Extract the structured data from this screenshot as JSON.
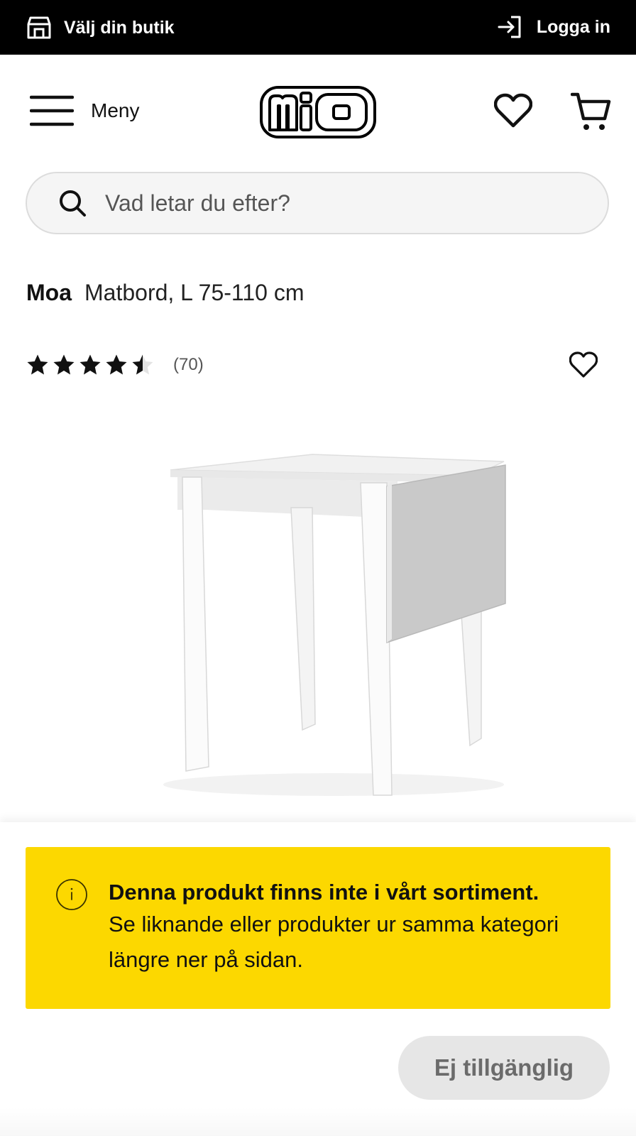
{
  "topbar": {
    "store_label": "Välj din butik",
    "login_label": "Logga in"
  },
  "header": {
    "menu_label": "Meny",
    "logo_text": "mio"
  },
  "search": {
    "placeholder": "Vad letar du efter?"
  },
  "product": {
    "brand": "Moa",
    "description": "Matbord, L 75-110 cm",
    "rating_value": 4.5,
    "rating_max": 5,
    "review_count": "(70)",
    "image_alt": "Vitt klaffbord"
  },
  "notice": {
    "title": "Denna produkt finns inte i vårt sortiment.",
    "body": "Se liknande eller produkter ur samma kategori längre ner på sidan."
  },
  "actions": {
    "unavailable_label": "Ej tillgänglig"
  },
  "colors": {
    "topbar": "#000000",
    "notice": "#fcd800",
    "button_disabled": "#e6e6e6"
  }
}
